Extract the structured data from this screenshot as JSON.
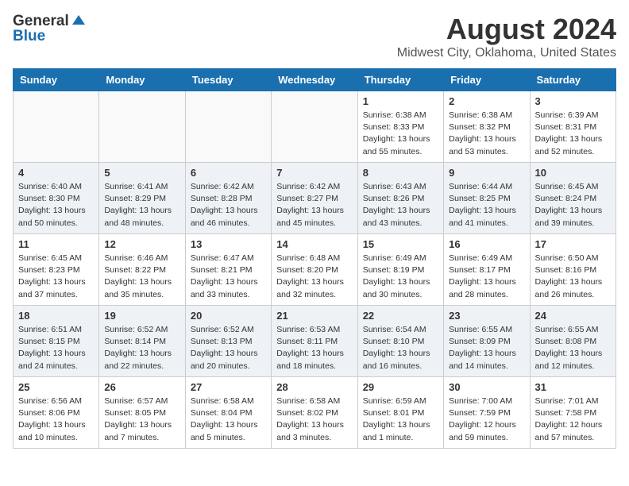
{
  "header": {
    "logo_general": "General",
    "logo_blue": "Blue",
    "main_title": "August 2024",
    "subtitle": "Midwest City, Oklahoma, United States"
  },
  "calendar": {
    "days_of_week": [
      "Sunday",
      "Monday",
      "Tuesday",
      "Wednesday",
      "Thursday",
      "Friday",
      "Saturday"
    ],
    "weeks": [
      {
        "alt": false,
        "days": [
          {
            "num": "",
            "empty": true
          },
          {
            "num": "",
            "empty": true
          },
          {
            "num": "",
            "empty": true
          },
          {
            "num": "",
            "empty": true
          },
          {
            "num": "1",
            "sunrise": "6:38 AM",
            "sunset": "8:33 PM",
            "daylight": "13 hours and 55 minutes."
          },
          {
            "num": "2",
            "sunrise": "6:38 AM",
            "sunset": "8:32 PM",
            "daylight": "13 hours and 53 minutes."
          },
          {
            "num": "3",
            "sunrise": "6:39 AM",
            "sunset": "8:31 PM",
            "daylight": "13 hours and 52 minutes."
          }
        ]
      },
      {
        "alt": true,
        "days": [
          {
            "num": "4",
            "sunrise": "6:40 AM",
            "sunset": "8:30 PM",
            "daylight": "13 hours and 50 minutes."
          },
          {
            "num": "5",
            "sunrise": "6:41 AM",
            "sunset": "8:29 PM",
            "daylight": "13 hours and 48 minutes."
          },
          {
            "num": "6",
            "sunrise": "6:42 AM",
            "sunset": "8:28 PM",
            "daylight": "13 hours and 46 minutes."
          },
          {
            "num": "7",
            "sunrise": "6:42 AM",
            "sunset": "8:27 PM",
            "daylight": "13 hours and 45 minutes."
          },
          {
            "num": "8",
            "sunrise": "6:43 AM",
            "sunset": "8:26 PM",
            "daylight": "13 hours and 43 minutes."
          },
          {
            "num": "9",
            "sunrise": "6:44 AM",
            "sunset": "8:25 PM",
            "daylight": "13 hours and 41 minutes."
          },
          {
            "num": "10",
            "sunrise": "6:45 AM",
            "sunset": "8:24 PM",
            "daylight": "13 hours and 39 minutes."
          }
        ]
      },
      {
        "alt": false,
        "days": [
          {
            "num": "11",
            "sunrise": "6:45 AM",
            "sunset": "8:23 PM",
            "daylight": "13 hours and 37 minutes."
          },
          {
            "num": "12",
            "sunrise": "6:46 AM",
            "sunset": "8:22 PM",
            "daylight": "13 hours and 35 minutes."
          },
          {
            "num": "13",
            "sunrise": "6:47 AM",
            "sunset": "8:21 PM",
            "daylight": "13 hours and 33 minutes."
          },
          {
            "num": "14",
            "sunrise": "6:48 AM",
            "sunset": "8:20 PM",
            "daylight": "13 hours and 32 minutes."
          },
          {
            "num": "15",
            "sunrise": "6:49 AM",
            "sunset": "8:19 PM",
            "daylight": "13 hours and 30 minutes."
          },
          {
            "num": "16",
            "sunrise": "6:49 AM",
            "sunset": "8:17 PM",
            "daylight": "13 hours and 28 minutes."
          },
          {
            "num": "17",
            "sunrise": "6:50 AM",
            "sunset": "8:16 PM",
            "daylight": "13 hours and 26 minutes."
          }
        ]
      },
      {
        "alt": true,
        "days": [
          {
            "num": "18",
            "sunrise": "6:51 AM",
            "sunset": "8:15 PM",
            "daylight": "13 hours and 24 minutes."
          },
          {
            "num": "19",
            "sunrise": "6:52 AM",
            "sunset": "8:14 PM",
            "daylight": "13 hours and 22 minutes."
          },
          {
            "num": "20",
            "sunrise": "6:52 AM",
            "sunset": "8:13 PM",
            "daylight": "13 hours and 20 minutes."
          },
          {
            "num": "21",
            "sunrise": "6:53 AM",
            "sunset": "8:11 PM",
            "daylight": "13 hours and 18 minutes."
          },
          {
            "num": "22",
            "sunrise": "6:54 AM",
            "sunset": "8:10 PM",
            "daylight": "13 hours and 16 minutes."
          },
          {
            "num": "23",
            "sunrise": "6:55 AM",
            "sunset": "8:09 PM",
            "daylight": "13 hours and 14 minutes."
          },
          {
            "num": "24",
            "sunrise": "6:55 AM",
            "sunset": "8:08 PM",
            "daylight": "13 hours and 12 minutes."
          }
        ]
      },
      {
        "alt": false,
        "days": [
          {
            "num": "25",
            "sunrise": "6:56 AM",
            "sunset": "8:06 PM",
            "daylight": "13 hours and 10 minutes."
          },
          {
            "num": "26",
            "sunrise": "6:57 AM",
            "sunset": "8:05 PM",
            "daylight": "13 hours and 7 minutes."
          },
          {
            "num": "27",
            "sunrise": "6:58 AM",
            "sunset": "8:04 PM",
            "daylight": "13 hours and 5 minutes."
          },
          {
            "num": "28",
            "sunrise": "6:58 AM",
            "sunset": "8:02 PM",
            "daylight": "13 hours and 3 minutes."
          },
          {
            "num": "29",
            "sunrise": "6:59 AM",
            "sunset": "8:01 PM",
            "daylight": "13 hours and 1 minute."
          },
          {
            "num": "30",
            "sunrise": "7:00 AM",
            "sunset": "7:59 PM",
            "daylight": "12 hours and 59 minutes."
          },
          {
            "num": "31",
            "sunrise": "7:01 AM",
            "sunset": "7:58 PM",
            "daylight": "12 hours and 57 minutes."
          }
        ]
      }
    ]
  }
}
